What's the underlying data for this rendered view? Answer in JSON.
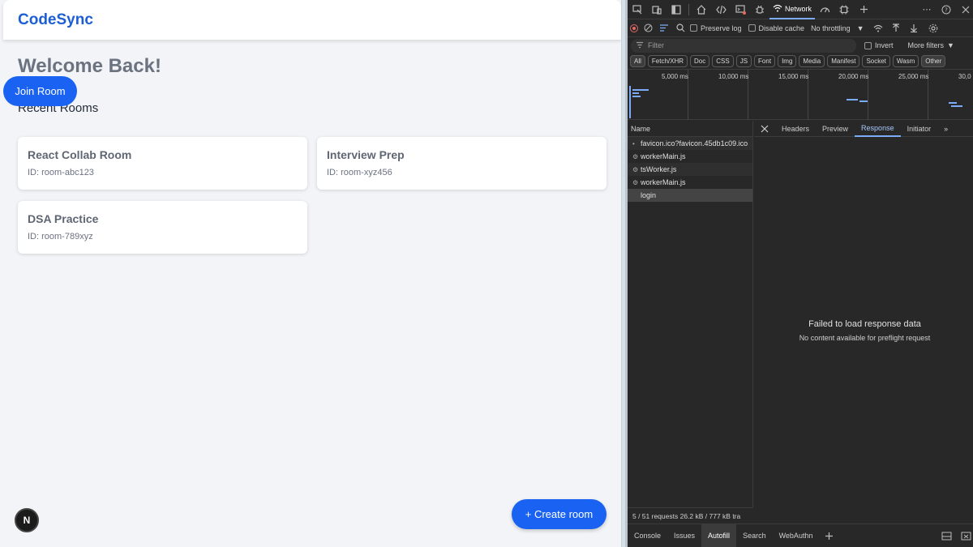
{
  "app": {
    "brand": "CodeSync",
    "welcome": "Welcome Back!",
    "join_button": "Join Room",
    "recent_title": "Recent Rooms",
    "rooms": [
      {
        "name": "React Collab Room",
        "id": "ID: room-abc123"
      },
      {
        "name": "Interview Prep",
        "id": "ID: room-xyz456"
      },
      {
        "name": "DSA Practice",
        "id": "ID: room-789xyz"
      }
    ],
    "create_button": "+ Create room",
    "next_badge": "N"
  },
  "devtools": {
    "active_panel": "Network",
    "preserve_log": "Preserve log",
    "disable_cache": "Disable cache",
    "throttling": "No throttling",
    "filter_placeholder": "Filter",
    "invert": "Invert",
    "more_filters": "More filters",
    "chips": [
      "All",
      "Fetch/XHR",
      "Doc",
      "CSS",
      "JS",
      "Font",
      "Img",
      "Media",
      "Manifest",
      "Socket",
      "Wasm",
      "Other"
    ],
    "timeline_ticks": [
      "5,000 ms",
      "10,000 ms",
      "15,000 ms",
      "20,000 ms",
      "25,000 ms",
      "30,0"
    ],
    "name_header": "Name",
    "requests": [
      {
        "name": "favicon.ico?favicon.45db1c09.ico",
        "icon": "•"
      },
      {
        "name": "workerMain.js",
        "icon": "⚙"
      },
      {
        "name": "tsWorker.js",
        "icon": "⚙"
      },
      {
        "name": "workerMain.js",
        "icon": "⚙"
      },
      {
        "name": "login",
        "icon": ""
      }
    ],
    "detail_tabs": [
      "Headers",
      "Preview",
      "Response",
      "Initiator"
    ],
    "empty_title": "Failed to load response data",
    "empty_sub": "No content available for preflight request",
    "status": "5 / 51 requests   26.2 kB / 777 kB tra",
    "drawer_tabs": [
      "Console",
      "Issues",
      "Autofill",
      "Search",
      "WebAuthn"
    ],
    "accent": "#7cacf8"
  }
}
